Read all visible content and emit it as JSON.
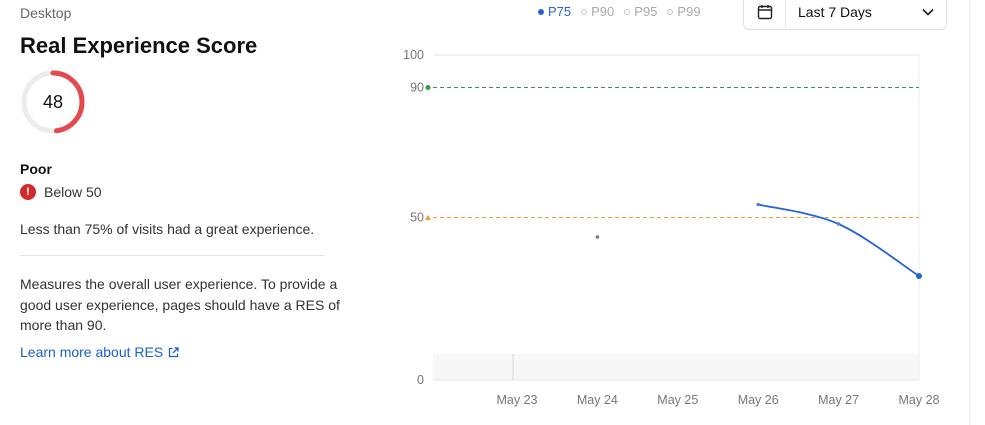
{
  "device_label": "Desktop",
  "title": "Real Experience Score",
  "score": {
    "value": "48",
    "fraction": 0.48,
    "color": "#e5484d",
    "track_color": "#ececec"
  },
  "rating": "Poor",
  "threshold_text": "Below 50",
  "threshold_icon": "exclamation-icon",
  "summary": "Less than 75% of visits had a great experience.",
  "description": "Measures the overall user experience. To provide a good user experience, pages should have a RES of more than 90.",
  "learn_more": "Learn more about RES",
  "legend": [
    {
      "label": "P75",
      "active": true
    },
    {
      "label": "P90",
      "active": false
    },
    {
      "label": "P95",
      "active": false
    },
    {
      "label": "P99",
      "active": false
    }
  ],
  "date_range": {
    "label": "Last 7 Days",
    "icon": "calendar-icon"
  },
  "colors": {
    "accent": "#2563d9",
    "good": "#2ea043",
    "needs_improvement": "#f0a030",
    "poor": "#e5484d"
  },
  "chart_data": {
    "type": "line",
    "x": [
      "May 23",
      "May 24",
      "May 25",
      "May 26",
      "May 27",
      "May 28"
    ],
    "ylim": [
      0,
      100
    ],
    "y_ticks": [
      "0",
      "50",
      "90",
      "100"
    ],
    "reference_lines": [
      {
        "label": "90",
        "value": 90,
        "color": "#2ea043"
      },
      {
        "label": "50",
        "value": 50,
        "color": "#f0a030"
      }
    ],
    "series": [
      {
        "name": "P75",
        "color": "#2563d9",
        "values": [
          null,
          44,
          null,
          54,
          48,
          32
        ]
      }
    ],
    "grid": true
  }
}
